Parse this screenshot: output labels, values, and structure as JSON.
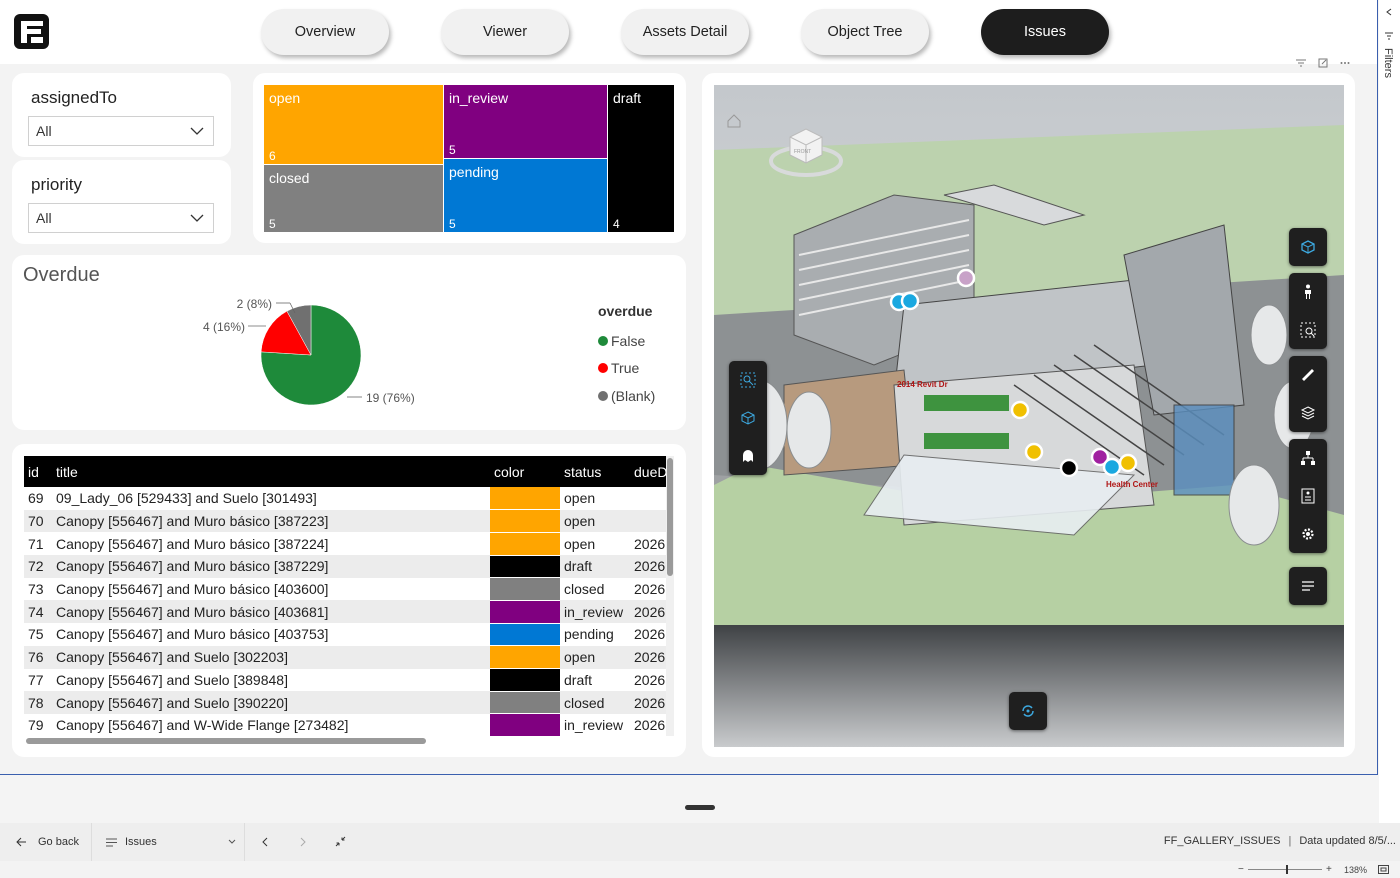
{
  "nav": {
    "tabs": [
      {
        "label": "Overview",
        "active": false
      },
      {
        "label": "Viewer",
        "active": false
      },
      {
        "label": "Assets Detail",
        "active": false
      },
      {
        "label": "Object Tree",
        "active": false
      },
      {
        "label": "Issues",
        "active": true
      }
    ]
  },
  "slicers": {
    "assigned": {
      "title": "assignedTo",
      "value": "All"
    },
    "priority": {
      "title": "priority",
      "value": "All"
    }
  },
  "treemap": {
    "cells": [
      {
        "label": "open",
        "count": "6",
        "color": "#ffa500"
      },
      {
        "label": "in_review",
        "count": "5",
        "color": "#800080"
      },
      {
        "label": "draft",
        "count": "4",
        "color": "#000000"
      },
      {
        "label": "closed",
        "count": "5",
        "color": "#808080"
      },
      {
        "label": "pending",
        "count": "5",
        "color": "#0078d4"
      }
    ]
  },
  "overdue": {
    "title": "Overdue",
    "legend_title": "overdue",
    "legend": [
      {
        "label": "False",
        "color": "#1e8a3a"
      },
      {
        "label": "True",
        "color": "#ff0000"
      },
      {
        "label": "(Blank)",
        "color": "#707070"
      }
    ],
    "labels": {
      "blank": "2 (8%)",
      "true": "4 (16%)",
      "false": "19 (76%)"
    }
  },
  "chart_data": {
    "type": "pie",
    "title": "Overdue",
    "slices": [
      {
        "label": "False",
        "value": 19,
        "percent": 76,
        "color": "#1e8a3a"
      },
      {
        "label": "True",
        "value": 4,
        "percent": 16,
        "color": "#ff0000"
      },
      {
        "label": "(Blank)",
        "value": 2,
        "percent": 8,
        "color": "#707070"
      }
    ],
    "legend_title": "overdue",
    "legend_position": "right"
  },
  "table": {
    "columns": [
      "id",
      "title",
      "color",
      "status",
      "dueD"
    ],
    "rows": [
      {
        "id": "69",
        "title": "09_Lady_06 [529433] and Suelo [301493]",
        "color": "#ffa500",
        "status": "open",
        "due": ""
      },
      {
        "id": "70",
        "title": "Canopy [556467] and Muro básico [387223]",
        "color": "#ffa500",
        "status": "open",
        "due": ""
      },
      {
        "id": "71",
        "title": "Canopy [556467] and Muro básico [387224]",
        "color": "#ffa500",
        "status": "open",
        "due": "2026"
      },
      {
        "id": "72",
        "title": "Canopy [556467] and Muro básico [387229]",
        "color": "#000000",
        "status": "draft",
        "due": "2026"
      },
      {
        "id": "73",
        "title": "Canopy [556467] and Muro básico [403600]",
        "color": "#808080",
        "status": "closed",
        "due": "2026"
      },
      {
        "id": "74",
        "title": "Canopy [556467] and Muro básico [403681]",
        "color": "#800080",
        "status": "in_review",
        "due": "2026"
      },
      {
        "id": "75",
        "title": "Canopy [556467] and Muro básico [403753]",
        "color": "#0078d4",
        "status": "pending",
        "due": "2026"
      },
      {
        "id": "76",
        "title": "Canopy [556467] and Suelo [302203]",
        "color": "#ffa500",
        "status": "open",
        "due": "2026"
      },
      {
        "id": "77",
        "title": "Canopy [556467] and Suelo [389848]",
        "color": "#000000",
        "status": "draft",
        "due": "2026"
      },
      {
        "id": "78",
        "title": "Canopy [556467] and Suelo [390220]",
        "color": "#808080",
        "status": "closed",
        "due": "2026"
      },
      {
        "id": "79",
        "title": "Canopy [556467] and W-Wide Flange [273482]",
        "color": "#800080",
        "status": "in_review",
        "due": "2026"
      }
    ]
  },
  "viewer": {
    "building_sign": "2014 Revit Dr",
    "center_sign": "Health Center",
    "cube_label": "FRONT"
  },
  "side_panel": {
    "label": "Filters"
  },
  "bottom": {
    "go_back": "Go back",
    "page_name": "Issues",
    "dataset": "FF_GALLERY_ISSUES",
    "updated": "Data updated 8/5/...",
    "zoom": "138%"
  },
  "colors": {
    "accent": "#1d1d1d",
    "border_accent": "#3a5fae"
  }
}
